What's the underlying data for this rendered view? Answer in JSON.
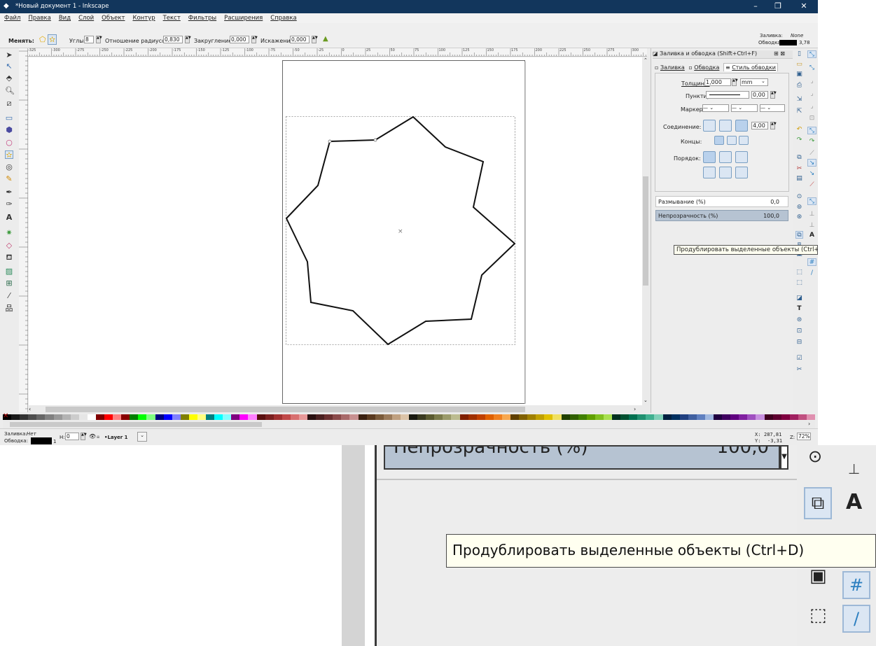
{
  "window": {
    "title": "*Новый документ 1 - Inkscape",
    "controls": [
      "–",
      "❐",
      "✕"
    ]
  },
  "menu": [
    "Файл",
    "Правка",
    "Вид",
    "Слой",
    "Объект",
    "Контур",
    "Текст",
    "Фильтры",
    "Расширения",
    "Справка"
  ],
  "toolcontrols": {
    "change_label": "Менять:",
    "corners_label": "Углы:",
    "corners_value": "8",
    "ratio_label": "Отношение радиусов:",
    "ratio_value": "0,830",
    "rounding_label": "Закругление:",
    "rounding_value": "0,000",
    "randomize_label": "Искажение:",
    "randomize_value": "0,000",
    "fill_label": "Заливка:",
    "fill_value": "None",
    "stroke_label": "Обводка:",
    "stroke_width": "3,78"
  },
  "ruler_labels": [
    "-325",
    "-300",
    "-275",
    "-250",
    "-225",
    "-200",
    "-175",
    "-150",
    "-125",
    "-100",
    "-75",
    "-50",
    "-25",
    "0",
    "25",
    "50",
    "75",
    "100",
    "125",
    "150",
    "175",
    "200",
    "225",
    "250",
    "275",
    "300"
  ],
  "dialog": {
    "title": "Заливка и обводка (Shift+Ctrl+F)",
    "tabs": [
      "Заливка",
      "Обводка",
      "Стиль обводки"
    ],
    "width_label": "Толщина:",
    "width_value": "1,000",
    "unit": "mm",
    "dash_label": "Пунктир:",
    "dash_value": "0,00",
    "markers_label": "Маркеры:",
    "join_label": "Соединение:",
    "miter_value": "4,00",
    "caps_label": "Концы:",
    "order_label": "Порядок:",
    "blur_label": "Размывание (%)",
    "blur_value": "0,0",
    "opacity_label": "Непрозрачность (%)",
    "opacity_value": "100,0"
  },
  "tooltip": "Продублировать выделенные объекты (Ctrl+D)",
  "status": {
    "fill_label": "Заливка:",
    "fill_value": "Нет",
    "stroke_label": "Обводка:",
    "stroke_num": "1",
    "h_label": "Н:",
    "h_value": "0",
    "layer": "•Layer 1",
    "x_label": "X:",
    "x_value": "287,81",
    "y_label": "Y:",
    "y_value": "-3,31",
    "z_label": "Z:",
    "zoom": "72%"
  },
  "zoom_crop": {
    "opacity_label": "Непрозрачность (%)",
    "opacity_value": "100,0",
    "tooltip": "Продублировать выделенные объекты (Ctrl+D)"
  },
  "colors": {
    "titlebar": "#12365c",
    "accent": "#2c7fc0"
  }
}
